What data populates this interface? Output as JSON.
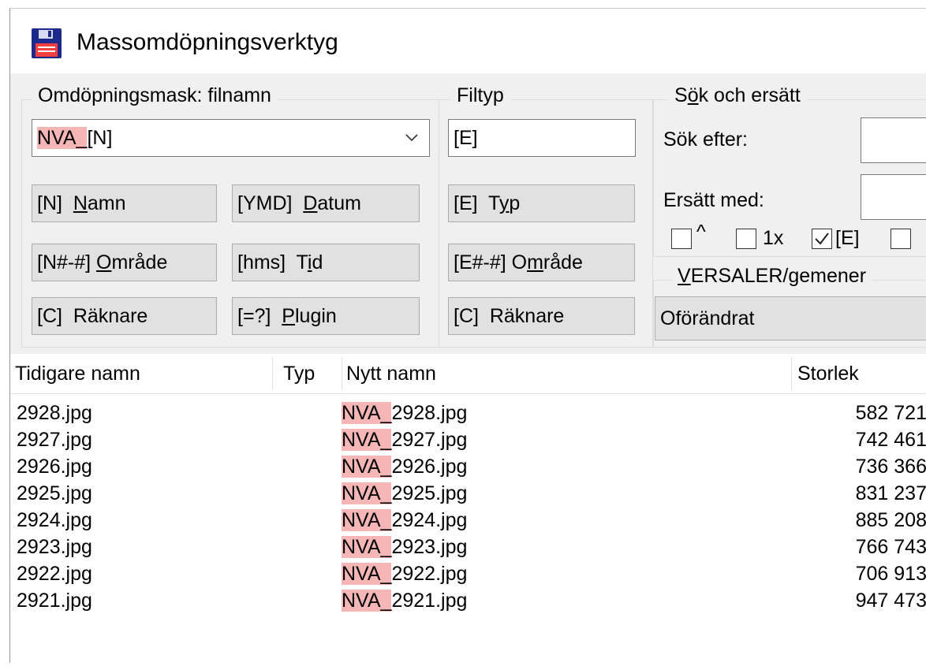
{
  "window": {
    "title": "Massomdöpningsverktyg",
    "icon": "floppy-disk-icon"
  },
  "mask_group": {
    "label": "Omdöpningsmask: filnamn",
    "value_highlight": "NVA_",
    "value_rest": "[N]",
    "buttons": {
      "name_prefix": "[N]  ",
      "name_underline": "N",
      "name_suffix": "amn",
      "date_prefix": "[YMD]  ",
      "date_underline": "D",
      "date_suffix": "atum",
      "range_prefix": "[N#-#] ",
      "range_underline": "O",
      "range_suffix": "mråde",
      "time_prefix": "[hms]  T",
      "time_underline": "i",
      "time_suffix": "d",
      "counter": "[C]  Räknare",
      "plugin_prefix": "[=?]  ",
      "plugin_underline": "P",
      "plugin_suffix": "lugin"
    }
  },
  "filetype_group": {
    "label": "Filtyp",
    "value": "[E]",
    "buttons": {
      "type_prefix": "[E]  T",
      "type_underline": "y",
      "type_suffix": "p",
      "range_prefix": "[E#-#] O",
      "range_underline": "m",
      "range_suffix": "råde",
      "counter": "[C]  Räknare"
    }
  },
  "search_group": {
    "label_prefix": "S",
    "label_underline": "ö",
    "label_suffix": "k och ersätt",
    "search_label": "Sök efter:",
    "replace_label": "Ersätt med:",
    "options": [
      {
        "label": "^",
        "checked": false
      },
      {
        "label": "1x",
        "checked": false
      },
      {
        "label": "[E]",
        "checked": true
      }
    ]
  },
  "case_group": {
    "label_underline": "V",
    "label_rest": "ERSALER/gemener",
    "value": "Oförändrat"
  },
  "list": {
    "columns": {
      "old": "Tidigare namn",
      "type": "Typ",
      "new": "Nytt namn",
      "size": "Storlek"
    },
    "rows": [
      {
        "old": "2928.jpg",
        "new_hl": "NVA_",
        "new_rest": "2928.jpg",
        "size": "582 721"
      },
      {
        "old": "2927.jpg",
        "new_hl": "NVA_",
        "new_rest": "2927.jpg",
        "size": "742 461"
      },
      {
        "old": "2926.jpg",
        "new_hl": "NVA_",
        "new_rest": "2926.jpg",
        "size": "736 366"
      },
      {
        "old": "2925.jpg",
        "new_hl": "NVA_",
        "new_rest": "2925.jpg",
        "size": "831 237"
      },
      {
        "old": "2924.jpg",
        "new_hl": "NVA_",
        "new_rest": "2924.jpg",
        "size": "885 208"
      },
      {
        "old": "2923.jpg",
        "new_hl": "NVA_",
        "new_rest": "2923.jpg",
        "size": "766 743"
      },
      {
        "old": "2922.jpg",
        "new_hl": "NVA_",
        "new_rest": "2922.jpg",
        "size": "706 913"
      },
      {
        "old": "2921.jpg",
        "new_hl": "NVA_",
        "new_rest": "2921.jpg",
        "size": "947 473"
      }
    ]
  },
  "colors": {
    "highlight": "#f6b6b6",
    "button_face": "#e1e1e1",
    "panel": "#f0f0f0"
  }
}
